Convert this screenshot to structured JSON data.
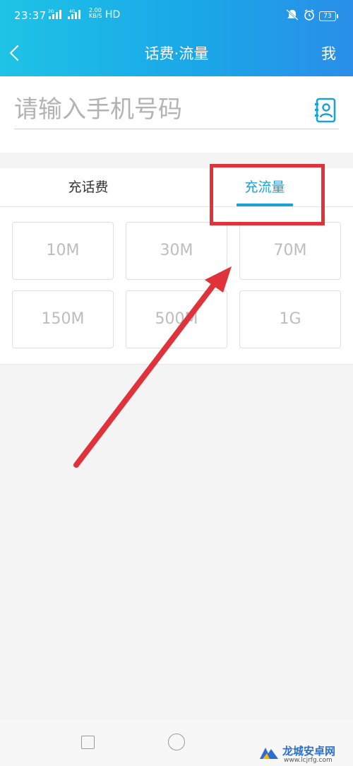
{
  "status_bar": {
    "time": "23:37",
    "signal1_label": "2G",
    "signal2_label": "4G",
    "speed_value": "2.00",
    "speed_unit": "KB/S",
    "hd": "HD",
    "battery": "73"
  },
  "navbar": {
    "title": "话费·流量",
    "right_label": "我",
    "back_icon": "chevron-left-icon"
  },
  "phone": {
    "placeholder": "请输入手机号码",
    "value": "",
    "contact_icon": "contact-book-icon"
  },
  "tabs": [
    {
      "label": "充话费",
      "active": false
    },
    {
      "label": "充流量",
      "active": true
    }
  ],
  "accent_color": "#1aa2d2",
  "annotation_color": "#e0323a",
  "options": [
    "10M",
    "30M",
    "70M",
    "150M",
    "500M",
    "1G"
  ],
  "watermark": {
    "text": "龙城安卓网",
    "url": "www.lcjrfg.com"
  }
}
